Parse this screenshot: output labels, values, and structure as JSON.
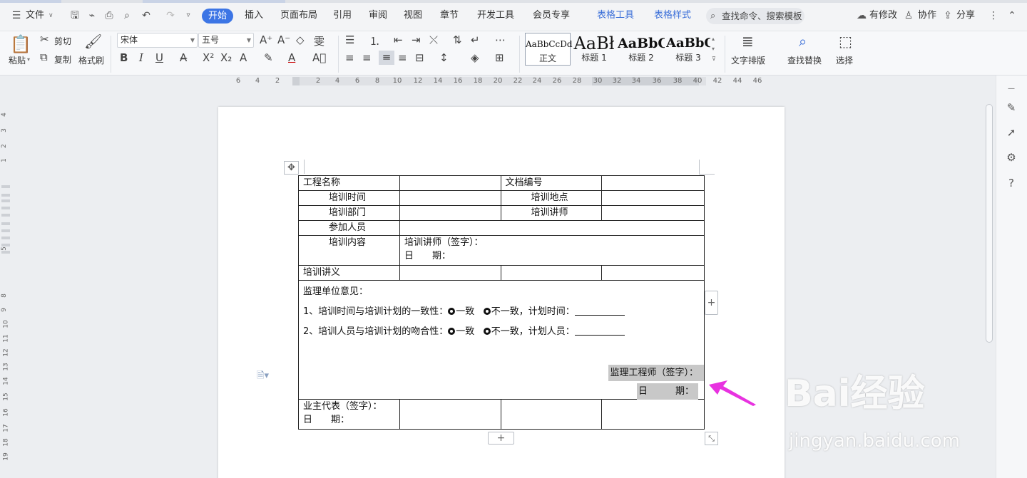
{
  "menubar": {
    "file": "文件",
    "active_tab": "开始",
    "tabs": [
      "插入",
      "页面布局",
      "引用",
      "审阅",
      "视图",
      "章节",
      "开发工具",
      "会员专享"
    ],
    "context_tabs": [
      "表格工具",
      "表格样式"
    ],
    "search_placeholder": "查找命令、搜索模板",
    "right": {
      "changes": "有修改",
      "collab": "协作",
      "share": "分享"
    }
  },
  "ribbon": {
    "paste": "粘贴",
    "cut": "剪切",
    "copy": "复制",
    "format_painter": "格式刷",
    "font_name": "宋体",
    "font_size": "五号",
    "styles": [
      {
        "sample": "AaBbCcDd",
        "name": "正文"
      },
      {
        "sample": "AaBł",
        "name": "标题 1"
      },
      {
        "sample": "AaBbC",
        "name": "标题 2"
      },
      {
        "sample": "AaBbC",
        "name": "标题 3"
      }
    ],
    "text_layout": "文字排版",
    "find_replace": "查找替换",
    "select": "选择"
  },
  "ruler": {
    "h_ticks": [
      "6",
      "4",
      "2",
      "2",
      "4",
      "6",
      "8",
      "10",
      "12",
      "14",
      "16",
      "18",
      "20",
      "22",
      "24",
      "26",
      "28",
      "30",
      "32",
      "34",
      "36",
      "38",
      "40",
      "42",
      "44",
      "46"
    ],
    "v_ticks": [
      "4",
      "3",
      "2",
      "1",
      "5",
      "8",
      "9",
      "10",
      "11",
      "12",
      "13",
      "14",
      "15",
      "16",
      "17",
      "18",
      "19"
    ]
  },
  "doc": {
    "row1": {
      "c1": "工程名称",
      "c3": "文档编号"
    },
    "row2": {
      "c1": "培训时间",
      "c3": "培训地点"
    },
    "row3": {
      "c1": "培训部门",
      "c3": "培训讲师"
    },
    "row4": {
      "c1": "参加人员"
    },
    "row5": {
      "c1": "培训内容",
      "sign": "培训讲师（签字）：",
      "date": "日　　期："
    },
    "row6": {
      "c1": "培训讲义"
    },
    "opinion": {
      "title": "监理单位意见：",
      "line1_prefix": "1、培训时间与培训计划的一致性：",
      "line1_opt1": "一致",
      "line1_opt2": "不一致，计划时间：",
      "line2_prefix": "2、培训人员与培训计划的吻合性：",
      "line2_opt1": "一致",
      "line2_opt2": "不一致，计划人员：",
      "sign": "监理工程师（签字）：",
      "date": "日　　　期："
    },
    "owner": {
      "sign": "业主代表（签字）：",
      "date": "日　　期："
    }
  },
  "watermark": {
    "brand": "Bai经验",
    "url": "jingyan.baidu.com"
  },
  "colors": {
    "accent": "#3c75e5",
    "arrow": "#e832e0"
  }
}
